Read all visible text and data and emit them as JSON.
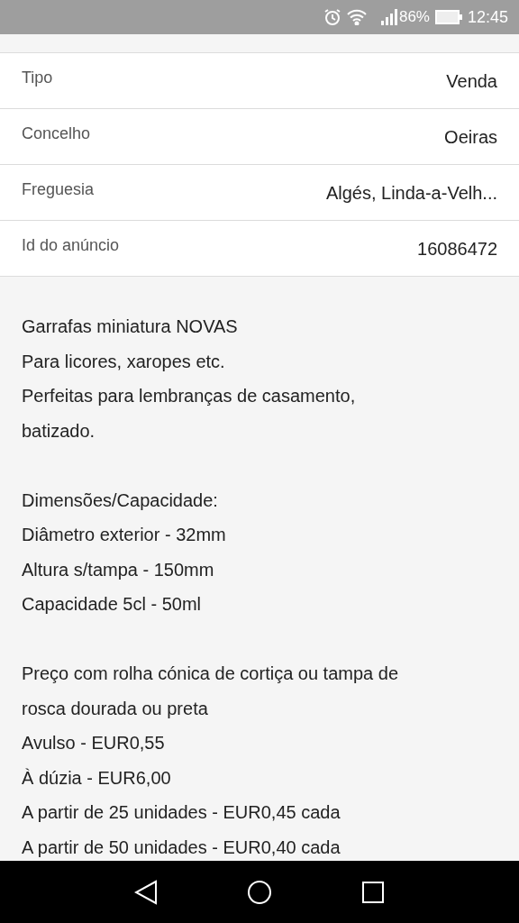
{
  "status_bar": {
    "battery": "86%",
    "time": "12:45"
  },
  "details": [
    {
      "label": "Tipo",
      "value": "Venda"
    },
    {
      "label": "Concelho",
      "value": "Oeiras"
    },
    {
      "label": "Freguesia",
      "value": "Algés, Linda-a-Velh..."
    },
    {
      "label": "Id do anúncio",
      "value": "16086472"
    }
  ],
  "description": [
    [
      "Garrafas miniatura NOVAS",
      "Para licores, xaropes etc.",
      "Perfeitas para lembranças de casamento,",
      "batizado."
    ],
    [
      "Dimensões/Capacidade:",
      "Diâmetro exterior - 32mm",
      "Altura s/tampa - 150mm",
      "Capacidade 5cl - 50ml"
    ],
    [
      "Preço com rolha cónica de cortiça ou tampa de",
      "rosca dourada ou preta",
      "Avulso - EUR0,55",
      "À dúzia - EUR6,00",
      "A partir de 25 unidades - EUR0,45 cada",
      "A partir de 50 unidades - EUR0,40 cada"
    ]
  ]
}
